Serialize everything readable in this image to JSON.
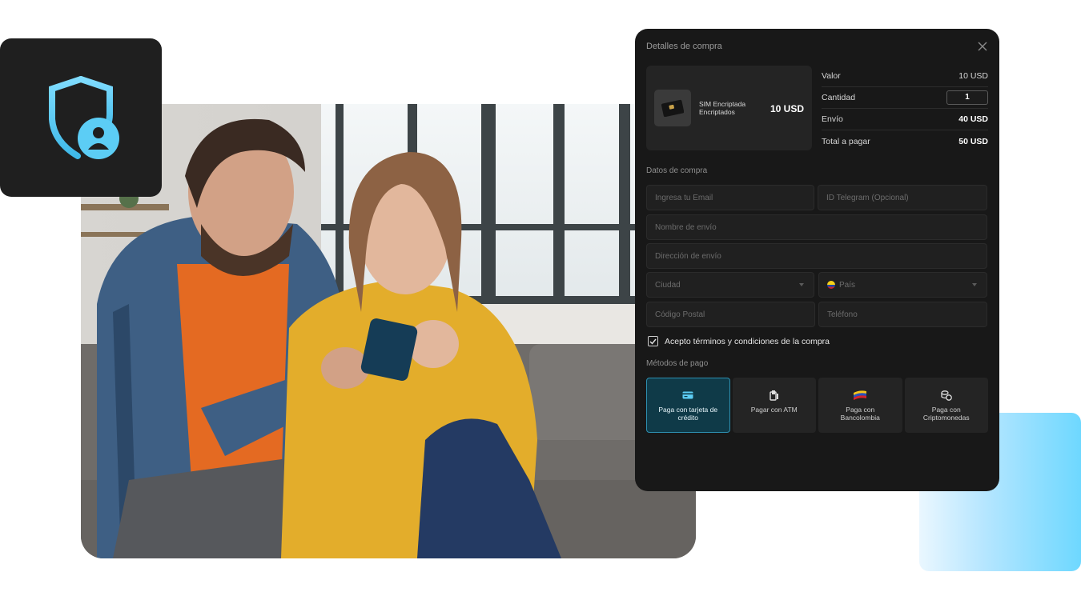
{
  "modal": {
    "title": "Detalles de compra",
    "product": {
      "name": "SIM Encriptada Encriptados",
      "price": "10 USD"
    },
    "summary": [
      {
        "label": "Valor",
        "value": "10 USD",
        "bold": false
      },
      {
        "label": "Cantidad",
        "value": "1",
        "is_input": true
      },
      {
        "label": "Envío",
        "value": "40 USD",
        "bold": true
      },
      {
        "label": "Total a pagar",
        "value": "50 USD",
        "bold": true
      }
    ],
    "form_section_label": "Datos de compra",
    "fields": {
      "email_placeholder": "Ingresa tu Email",
      "telegram_placeholder": "ID Telegram (Opcional)",
      "name_placeholder": "Nombre de envío",
      "address_placeholder": "Dirección de envío",
      "city_placeholder": "Ciudad",
      "country_placeholder": "País",
      "postal_placeholder": "Código Postal",
      "phone_placeholder": "Teléfono"
    },
    "terms_label": "Acepto términos y condiciones de la compra",
    "terms_checked": true,
    "payment_section_label": "Métodos de pago",
    "payment_methods": [
      {
        "label": "Paga con tarjeta de crédito",
        "icon": "credit-card-icon",
        "active": true
      },
      {
        "label": "Pagar con ATM",
        "icon": "atm-icon",
        "active": false
      },
      {
        "label": "Paga con Bancolombia",
        "icon": "bancolombia-icon",
        "active": false
      },
      {
        "label": "Paga con Criptomonedas",
        "icon": "crypto-coins-icon",
        "active": false
      }
    ]
  },
  "colors": {
    "accent": "#5ccdf5",
    "modal_bg": "#181818",
    "active_payment_bg": "#0f3a48"
  }
}
